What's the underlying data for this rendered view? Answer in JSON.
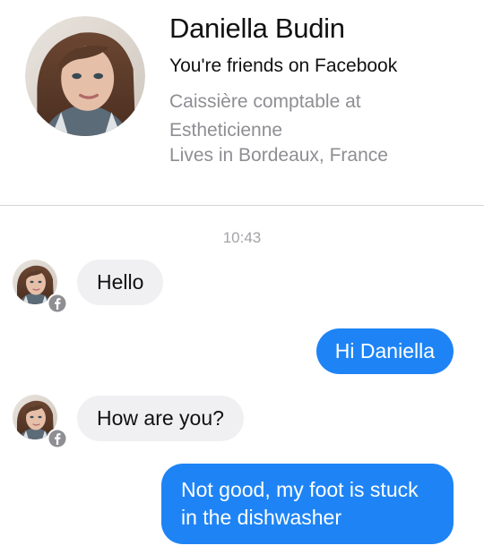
{
  "profile": {
    "name": "Daniella Budin",
    "friends_status": "You're friends on Facebook",
    "job": "Caissière comptable at Estheticienne",
    "location": "Lives in Bordeaux, France",
    "avatar_icon": "profile-photo"
  },
  "conversation": {
    "timestamp": "10:43",
    "messages": [
      {
        "sender": "contact",
        "text": "Hello",
        "show_avatar": true
      },
      {
        "sender": "me",
        "text": "Hi Daniella"
      },
      {
        "sender": "contact",
        "text": "How are you?",
        "show_avatar": true
      },
      {
        "sender": "me",
        "text": "Not good, my foot is stuck in the dishwasher"
      }
    ]
  },
  "colors": {
    "outgoing_bubble": "#1e84f6",
    "incoming_bubble": "#f0f0f2",
    "secondary_text": "#8e8e93",
    "facebook_badge": "#3b5998"
  }
}
